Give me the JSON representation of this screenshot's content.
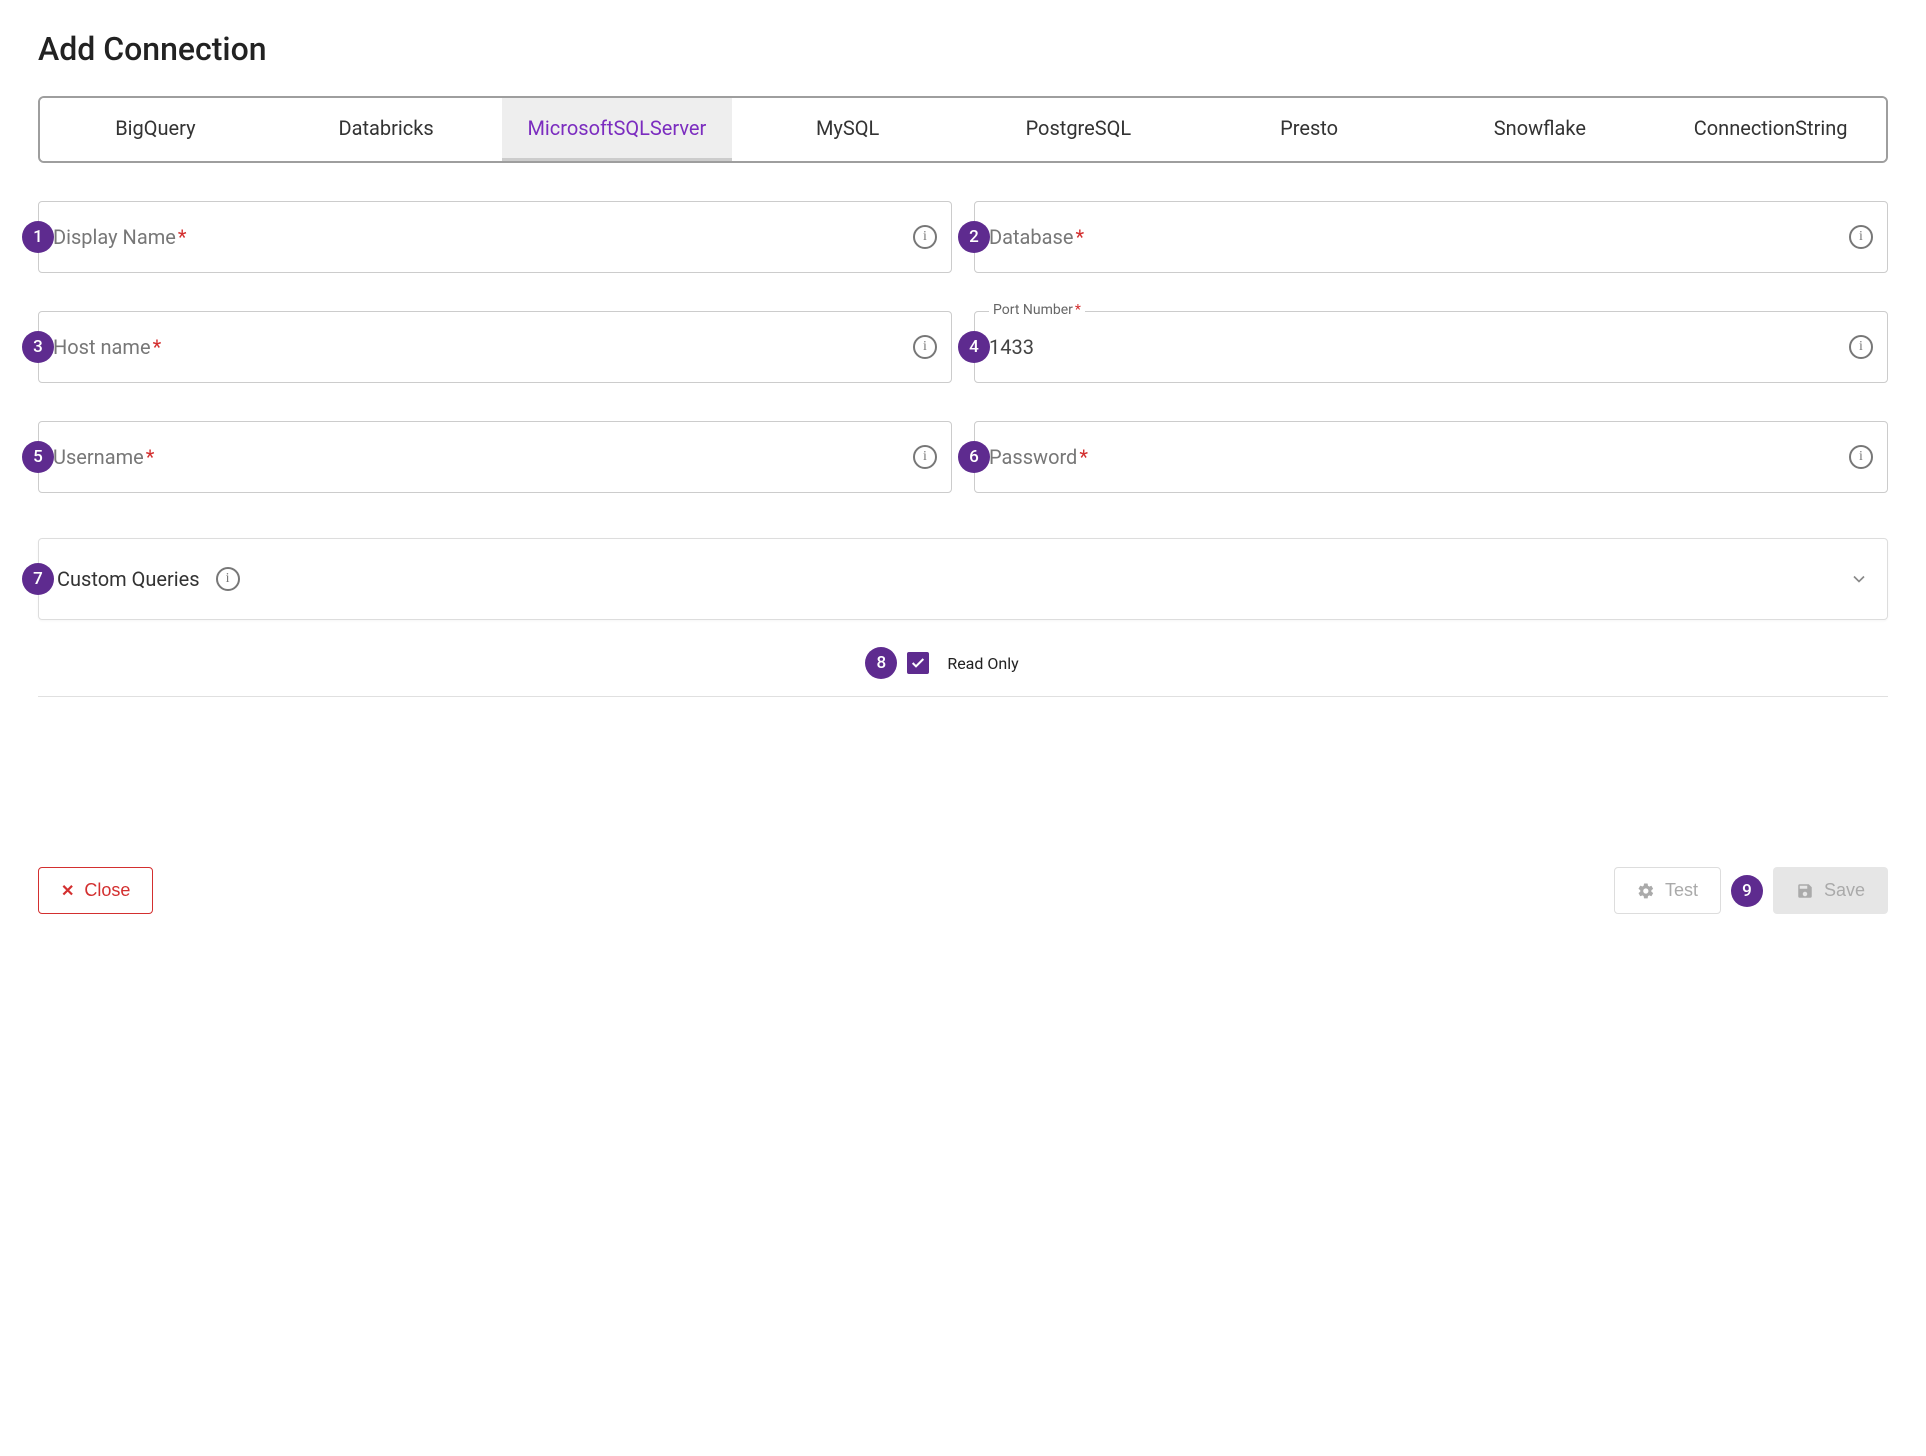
{
  "title": "Add Connection",
  "tabs": [
    {
      "label": "BigQuery",
      "active": false
    },
    {
      "label": "Databricks",
      "active": false
    },
    {
      "label": "MicrosoftSQLServer",
      "active": true
    },
    {
      "label": "MySQL",
      "active": false
    },
    {
      "label": "PostgreSQL",
      "active": false
    },
    {
      "label": "Presto",
      "active": false
    },
    {
      "label": "Snowflake",
      "active": false
    },
    {
      "label": "ConnectionString",
      "active": false
    }
  ],
  "fields": {
    "displayName": {
      "label": "Display Name",
      "required": true,
      "badge": "1"
    },
    "database": {
      "label": "Database",
      "required": true,
      "badge": "2"
    },
    "hostName": {
      "label": "Host name",
      "required": true,
      "badge": "3"
    },
    "portNumber": {
      "label": "Port Number",
      "required": true,
      "value": "1433",
      "badge": "4"
    },
    "username": {
      "label": "Username",
      "required": true,
      "badge": "5"
    },
    "password": {
      "label": "Password",
      "required": true,
      "badge": "6"
    }
  },
  "accordion": {
    "label": "Custom Queries",
    "badge": "7"
  },
  "readOnly": {
    "label": "Read Only",
    "checked": true,
    "badge": "8"
  },
  "footer": {
    "close": "Close",
    "test": "Test",
    "save": "Save",
    "saveBadge": "9"
  }
}
